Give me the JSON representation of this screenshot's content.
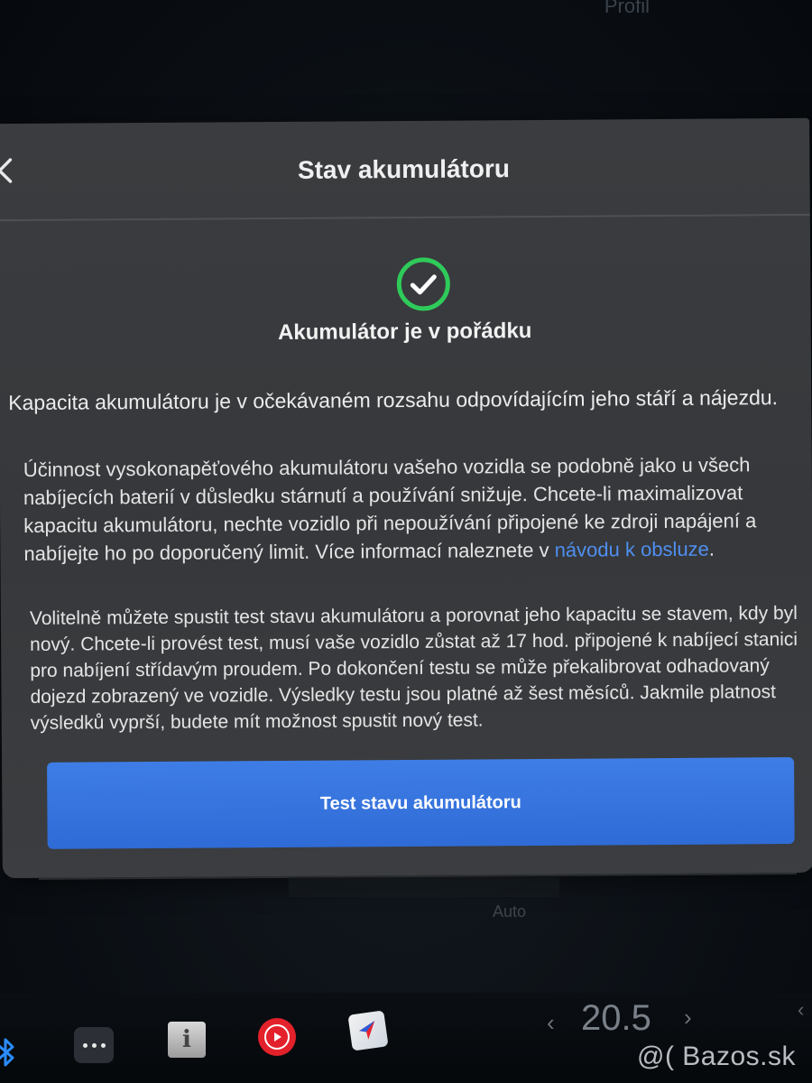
{
  "background": {
    "top_label": "Profil",
    "auto_label": "Auto"
  },
  "modal": {
    "title": "Stav akumulátoru",
    "status_icon": "check-circle-icon",
    "status_color": "#2fcb5a",
    "status_text": "Akumulátor je v pořádku",
    "paragraph1": "Kapacita akumulátoru je v očekávaném rozsahu odpovídajícím jeho stáří a nájezdu.",
    "paragraph2_text": "Účinnost vysokonapěťového akumulátoru vašeho vozidla se podobně jako u všech nabíjecích baterií v důsledku stárnutí a používání snižuje. Chcete-li maximalizovat kapacitu akumulátoru, nechte vozidlo při nepoužívání připojené ke zdroji napájení a nabíjejte ho po doporučený limit. Více informací naleznete v ",
    "paragraph2_link": "návodu k obsluze",
    "paragraph2_end": ".",
    "paragraph3": "Volitelně můžete spustit test stavu akumulátoru a porovnat jeho kapacitu se stavem, kdy byl nový. Chcete-li provést test, musí vaše vozidlo zůstat až 17 hod. připojené k nabíjecí stanici pro nabíjení střídavým proudem. Po dokončení testu se může překalibrovat odhadovaný dojezd zobrazený ve vozidle. Výsledky testu jsou platné až šest měsíců. Jakmile platnost výsledků vyprší, budete mít možnost spustit nový test.",
    "button_label": "Test stavu akumulátoru",
    "button_color": "#3574de",
    "link_color": "#4f8ff0"
  },
  "taskbar": {
    "icons": [
      "bluetooth-icon",
      "more-dots-icon",
      "manual-info-icon",
      "youtube-music-icon",
      "navigation-icon"
    ],
    "temp_left_arrow": "‹",
    "temperature": "20.5",
    "temp_right_arrow": "›",
    "far_right_arrow": "‹"
  },
  "watermark": "@( Bazos.sk"
}
